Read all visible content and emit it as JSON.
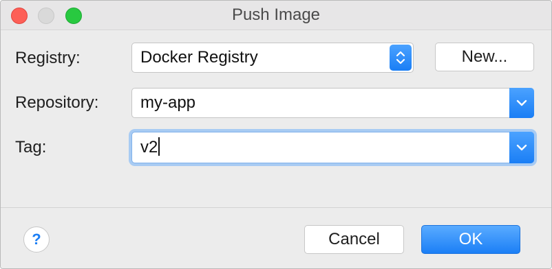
{
  "window": {
    "title": "Push Image"
  },
  "form": {
    "registry": {
      "label": "Registry:",
      "value": "Docker Registry",
      "new_button_label": "New..."
    },
    "repository": {
      "label": "Repository:",
      "value": "my-app"
    },
    "tag": {
      "label": "Tag:",
      "value": "v2"
    }
  },
  "footer": {
    "help_label": "?",
    "cancel_label": "Cancel",
    "ok_label": "OK"
  },
  "colors": {
    "accent": "#1a7ef5",
    "close": "#fd5f57",
    "maximize": "#28c940",
    "minimize_disabled": "#d9d9d9"
  },
  "icons": {
    "stepper": "up-down-chevron-icon",
    "dropdown": "chevron-down-icon",
    "help": "help-icon"
  }
}
